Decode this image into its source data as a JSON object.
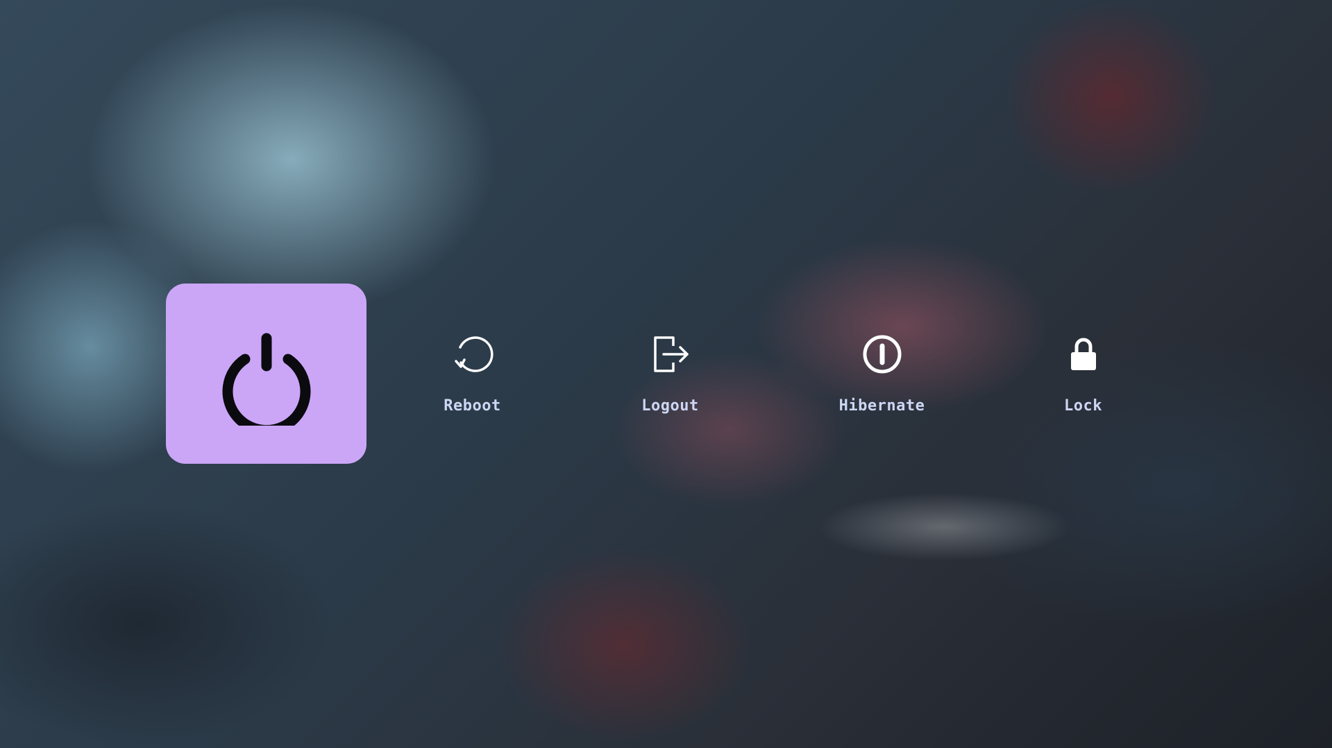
{
  "menu": {
    "items": [
      {
        "id": "shutdown",
        "label": "",
        "icon": "power-icon",
        "selected": true
      },
      {
        "id": "reboot",
        "label": "Reboot",
        "icon": "reboot-icon",
        "selected": false
      },
      {
        "id": "logout",
        "label": "Logout",
        "icon": "logout-icon",
        "selected": false
      },
      {
        "id": "hibernate",
        "label": "Hibernate",
        "icon": "hibernate-icon",
        "selected": false
      },
      {
        "id": "lock",
        "label": "Lock",
        "icon": "lock-icon",
        "selected": false
      }
    ]
  },
  "colors": {
    "accent": "#cba6f7",
    "text": "#cdd6f4",
    "icon": "#ffffff",
    "selected_icon": "#0b0b0f"
  }
}
